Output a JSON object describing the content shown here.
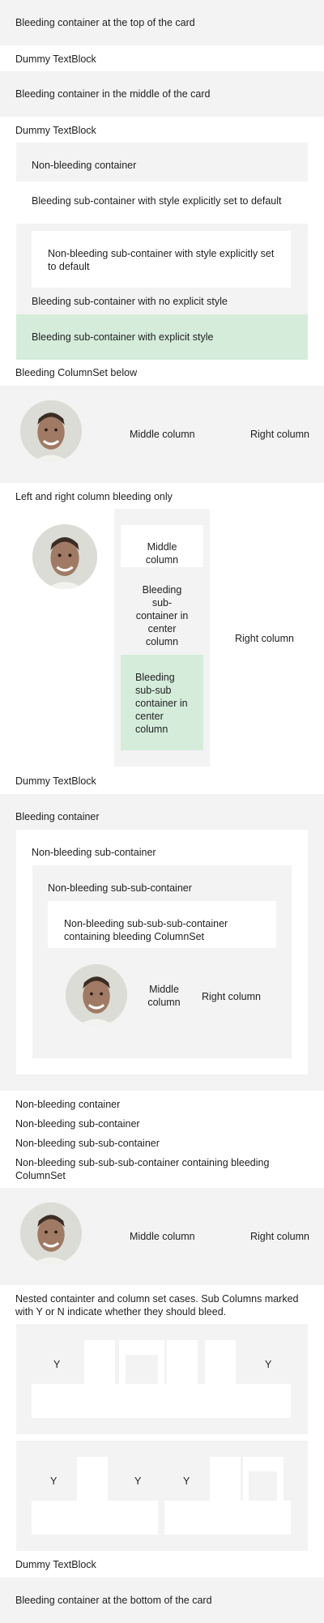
{
  "texts": {
    "top": "Bleeding container at the top of the card",
    "dummy1": "Dummy TextBlock",
    "middle": "Bleeding container in the middle of the card",
    "dummy2": "Dummy TextBlock",
    "nonbleed": "Non-bleeding container",
    "sub_default": "Bleeding sub-container with style explicitly set to default",
    "nonbleed_sub_default": "Non-bleeding sub-container with style explicitly set to default",
    "sub_noexplicit": "Bleeding sub-container with no explicit style",
    "sub_explicit": "Bleeding sub-container with explicit style",
    "colset_below": "Bleeding ColumnSet below",
    "cs1_middle": "Middle column",
    "cs1_right": "Right column",
    "lr_only": "Left and right column bleeding only",
    "lr_middle": "Middle column",
    "lr_bleed_sub": "Bleeding sub-container in center column",
    "lr_bleed_subsub": "Bleeding sub-sub container in center column",
    "lr_right": "Right column",
    "dummy3": "Dummy TextBlock",
    "bleed_container": "Bleeding container",
    "nb_sub": "Non-bleeding sub-container",
    "nb_subsub": "Non-bleeding sub-sub-container",
    "nb_subsubsub": "Non-bleeding sub-sub-sub-container containing bleeding ColumnSet",
    "cs2_middle": "Middle column",
    "cs2_right": "Right column",
    "nb2_container": "Non-bleeding container",
    "nb2_sub": "Non-bleeding sub-container",
    "nb2_subsub": "Non-bleeding sub-sub-container",
    "nb2_subsubsub": "Non-bleeding sub-sub-sub-container containing bleeding ColumnSet",
    "cs3_middle": "Middle column",
    "cs3_right": "Right column",
    "nested_desc": "Nested containter and column set cases. Sub Columns marked with Y or N indicate whether they should bleed.",
    "n1_y1": "Y",
    "n1_y2": "Y",
    "n2_y1": "Y",
    "n2_y2": "Y",
    "n2_y3": "Y",
    "dummy4": "Dummy TextBlock",
    "bottom": "Bleeding container at the bottom of the card"
  },
  "colors": {
    "emphasis": "#f3f3f3",
    "good": "#d5ecdb",
    "default": "#ffffff"
  },
  "icons": {
    "avatar": "person-photo-icon"
  }
}
